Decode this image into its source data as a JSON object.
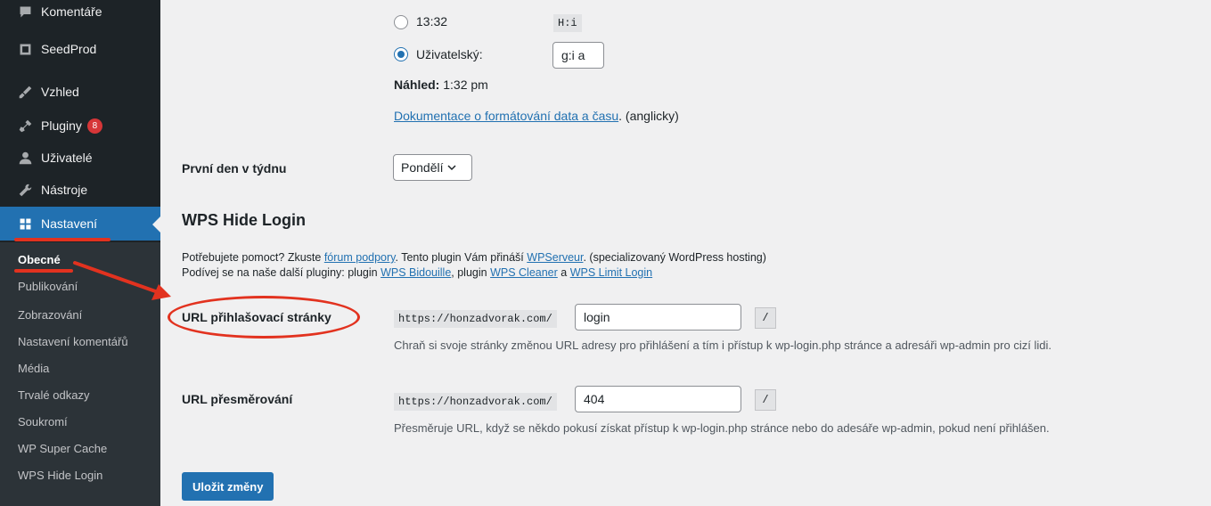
{
  "sidebar": {
    "menu": [
      {
        "label": "Komentáře",
        "icon": "comment-icon"
      },
      {
        "label": "SeedProd",
        "icon": "seedprod-icon"
      },
      {
        "label": "Vzhled",
        "icon": "appearance-brush-icon"
      },
      {
        "label": "Pluginy",
        "icon": "plugin-icon",
        "badge": "8"
      },
      {
        "label": "Uživatelé",
        "icon": "users-icon"
      },
      {
        "label": "Nástroje",
        "icon": "tools-wrench-icon"
      },
      {
        "label": "Nastavení",
        "icon": "settings-icon"
      }
    ],
    "submenu": [
      "Obecné",
      "Publikování",
      "Zobrazování",
      "Nastavení komentářů",
      "Média",
      "Trvalé odkazy",
      "Soukromí",
      "WP Super Cache",
      "WPS Hide Login"
    ]
  },
  "time_format": {
    "option_1_label": "13:32",
    "option_1_code": "H:i",
    "option_2_label": "Uživatelský:",
    "custom_value": "g:i a",
    "preview_label": "Náhled:",
    "preview_value": "1:32 pm",
    "doc_link": "Dokumentace o formátování data a času",
    "doc_suffix": ". (anglicky)"
  },
  "first_day": {
    "label": "První den v týdnu",
    "value": "Pondělí"
  },
  "wps": {
    "heading": "WPS Hide Login",
    "help_1": "Potřebujete pomoct? Zkuste ",
    "help_link_forum": "fórum podpory",
    "help_2": ". Tento plugin Vám přináší ",
    "help_link_wpserveur": "WPServeur",
    "help_3": ". (specializovaný WordPress hosting)",
    "plugins_1": "Podívej se na naše další pluginy: plugin ",
    "plugins_link_bidouille": "WPS Bidouille",
    "plugins_2": ", plugin ",
    "plugins_link_cleaner": "WPS Cleaner",
    "plugins_3": " a ",
    "plugins_link_limit": "WPS Limit Login",
    "login_url_label": "URL přihlašovací stránky",
    "login_url_prefix": "https://honzadvorak.com/",
    "login_url_value": "login",
    "login_url_suffix": "/",
    "login_url_desc": "Chraň si svoje stránky změnou URL adresy pro přihlášení a tím i přístup k wp-login.php stránce a adresáři wp-admin pro cizí lidi.",
    "redirect_label": "URL přesměrování",
    "redirect_prefix": "https://honzadvorak.com/",
    "redirect_value": "404",
    "redirect_suffix": "/",
    "redirect_desc": "Přesměruje URL, když se někdo pokusí získat přístup k wp-login.php stránce nebo do adesáře wp-admin, pokud není přihlášen."
  },
  "save_button": "Uložit změny",
  "annotation_color": "#e2321f",
  "colors": {
    "accent": "#2271b1",
    "sidebar": "#1d2327",
    "badge": "#d63638"
  }
}
